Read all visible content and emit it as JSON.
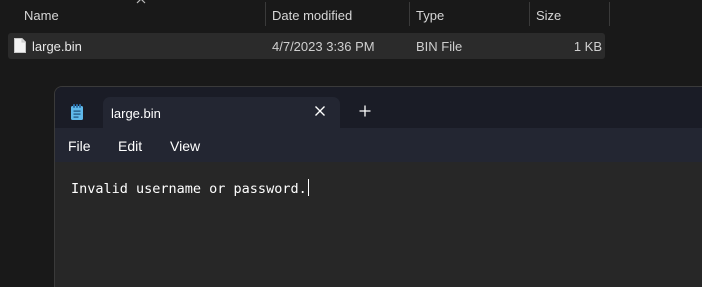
{
  "explorer": {
    "columns": {
      "name": "Name",
      "date_modified": "Date modified",
      "type": "Type",
      "size": "Size"
    },
    "files": [
      {
        "name": "large.bin",
        "date_modified": "4/7/2023 3:36 PM",
        "type": "BIN File",
        "size": "1 KB"
      }
    ]
  },
  "notepad": {
    "tab_title": "large.bin",
    "menu": [
      "File",
      "Edit",
      "View"
    ],
    "content": "Invalid username or password."
  }
}
